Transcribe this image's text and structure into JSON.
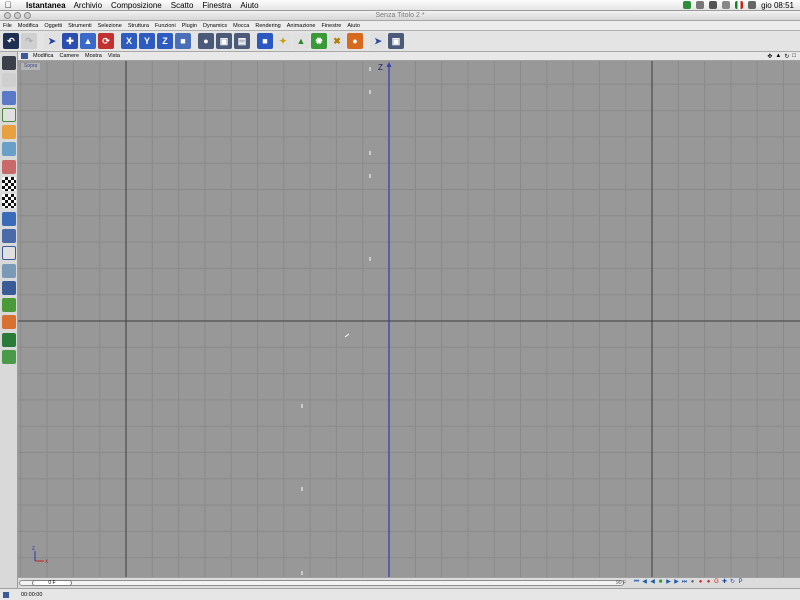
{
  "mac_menubar": {
    "app_name": "Istantanea",
    "items": [
      "Archivio",
      "Composizione",
      "Scatto",
      "Finestra",
      "Aiuto"
    ],
    "clock": "gio 08:51"
  },
  "window": {
    "title": "Senza Titolo 2 *"
  },
  "app_menu": [
    "File",
    "Modifica",
    "Oggetti",
    "Strumenti",
    "Selezione",
    "Struttura",
    "Funzioni",
    "Plugin",
    "Dynamics",
    "Mocca",
    "Rendering",
    "Animazione",
    "Finestre",
    "Aiuto"
  ],
  "toolbar_icons": [
    "undo-icon",
    "redo-icon",
    "move-pointer-icon",
    "move-tool-icon",
    "scale-tool-icon",
    "rotate-tool-icon",
    "x-axis-lock-icon",
    "y-axis-lock-icon",
    "z-axis-lock-icon",
    "coordinate-system-icon",
    "render-view-icon",
    "render-region-icon",
    "render-manager-icon",
    "cube-primitive-icon",
    "spline-icon",
    "nurbs-icon",
    "deformer-icon",
    "array-icon",
    "scene-icon",
    "camera-icon",
    "light-icon"
  ],
  "left_palette_icons": [
    "layout-icon",
    "object-icon",
    "model-icon",
    "axis-icon",
    "points-icon",
    "edges-icon",
    "polygons-icon",
    "texture-icon",
    "texture-axis-icon",
    "bone-icon",
    "animation-icon",
    "tweak-icon",
    "snap-icon",
    "workplane-icon",
    "magnet-icon",
    "bevel-icon",
    "paint-icon",
    "check-icon"
  ],
  "viewport_menu": [
    "Modifica",
    "Camere",
    "Mostra",
    "Vista"
  ],
  "viewport": {
    "label": "Sopra",
    "z_axis_label": "Z",
    "gizmo_z": "z",
    "gizmo_x": "x",
    "colors": {
      "background": "#989898",
      "grid_minor": "#8a8a8a",
      "grid_major": "#3c3c3c",
      "z_axis": "#3a3fb0"
    }
  },
  "timeline": {
    "frame_field": "0 F",
    "end_frame": "90 F"
  },
  "transport_icons": [
    "go-start-icon",
    "prev-key-icon",
    "play-back-icon",
    "stop-icon",
    "play-icon",
    "next-key-icon",
    "go-end-icon",
    "record-icon",
    "autokey-icon",
    "keyframe-icon",
    "position-key-icon",
    "scale-key-icon",
    "rotation-key-icon",
    "parameter-key-icon"
  ],
  "status": {
    "time": "00:00:00"
  }
}
